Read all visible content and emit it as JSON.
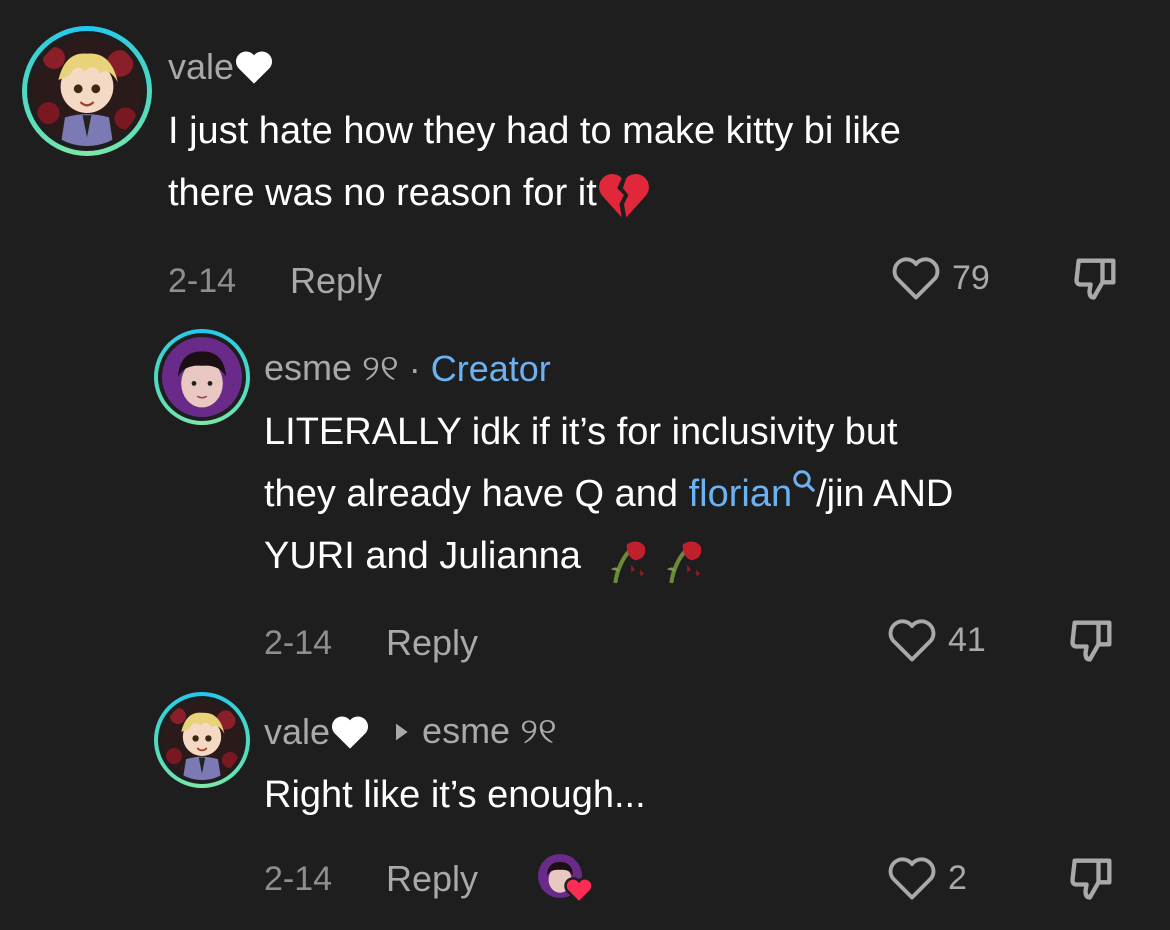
{
  "comments": [
    {
      "author": "vale",
      "author_emoji": "white-heart-icon",
      "text_line1": "I just hate how they had to make kitty bi like",
      "text_line2": "there was no reason for it",
      "text_emoji": "broken-heart-icon",
      "date": "2-14",
      "reply_label": "Reply",
      "likes": "79"
    },
    {
      "author": "esme ୨୧",
      "separator": "·",
      "badge": "Creator",
      "text_line1": "LITERALLY idk if it’s for inclusivity but",
      "text_line2_pre": "they already have Q and ",
      "text_line2_link": "florian",
      "text_line2_post": "/jin AND",
      "text_line3": "YURI and Julianna",
      "text_emoji": "wilted-rose-icon",
      "date": "2-14",
      "reply_label": "Reply",
      "likes": "41"
    },
    {
      "author": "vale",
      "author_emoji": "white-heart-icon",
      "reply_to": "esme ୨୧",
      "text_line1": "Right like it’s enough...",
      "date": "2-14",
      "reply_label": "Reply",
      "likes": "2"
    }
  ],
  "colors": {
    "background": "#1e1e1e",
    "text": "#ffffff",
    "secondary": "#a9a9a9",
    "link": "#6cb2f2",
    "ring_start": "#21c7f0",
    "ring_end": "#7ee8a8"
  }
}
